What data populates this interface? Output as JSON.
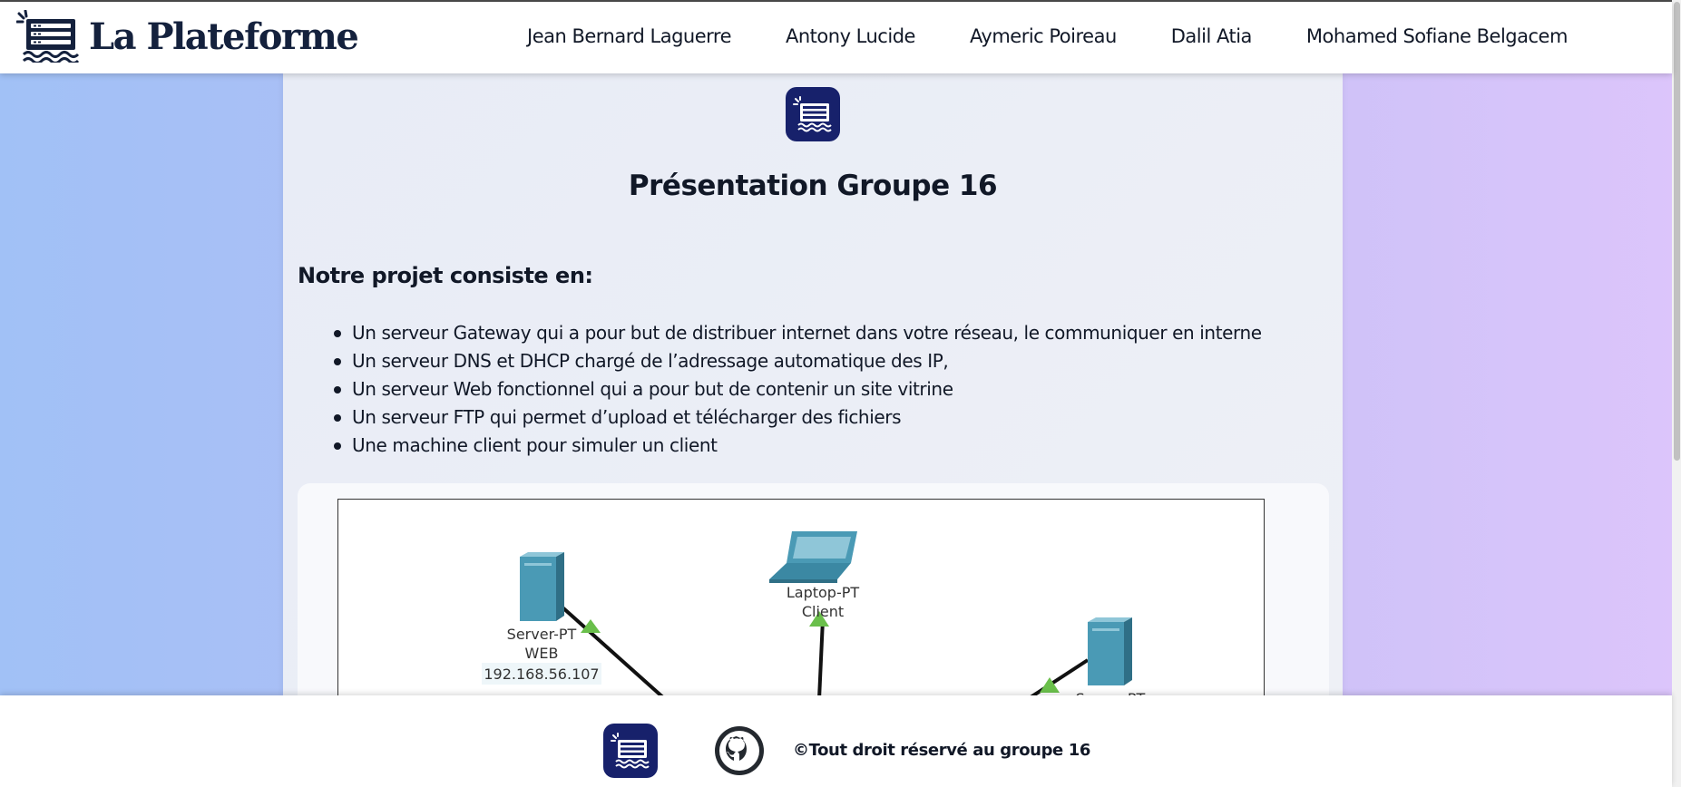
{
  "header": {
    "brand": "La Plateforme",
    "nav": [
      "Jean Bernard Laguerre",
      "Antony Lucide",
      "Aymeric Poireau",
      "Dalil Atia",
      "Mohamed Sofiane Belgacem"
    ]
  },
  "main": {
    "title": "Présentation Groupe 16",
    "intro": "Notre projet consiste en:",
    "features": [
      "Un serveur Gateway qui a pour but de distribuer internet dans votre réseau, le communiquer en interne",
      "Un serveur DNS et DHCP chargé de l’adressage automatique des IP,",
      "Un serveur Web fonctionnel qui a pour but de contenir un site vitrine",
      "Un serveur FTP qui permet d’upload et télécharger des fichiers",
      "Une machine client pour simuler un client"
    ],
    "diagram": {
      "web_server": {
        "type": "Server-PT",
        "name": "WEB",
        "ip": "192.168.56.107"
      },
      "client": {
        "type": "Laptop-PT",
        "name": "Client"
      },
      "third_server": {
        "type": "Server-PT"
      }
    }
  },
  "footer": {
    "copyright": "©Tout droit réservé au groupe 16"
  },
  "colors": {
    "brand_navy": "#17216b",
    "text": "#111827",
    "server_teal": "#4a9ab5",
    "link_green": "#6abf4b"
  }
}
